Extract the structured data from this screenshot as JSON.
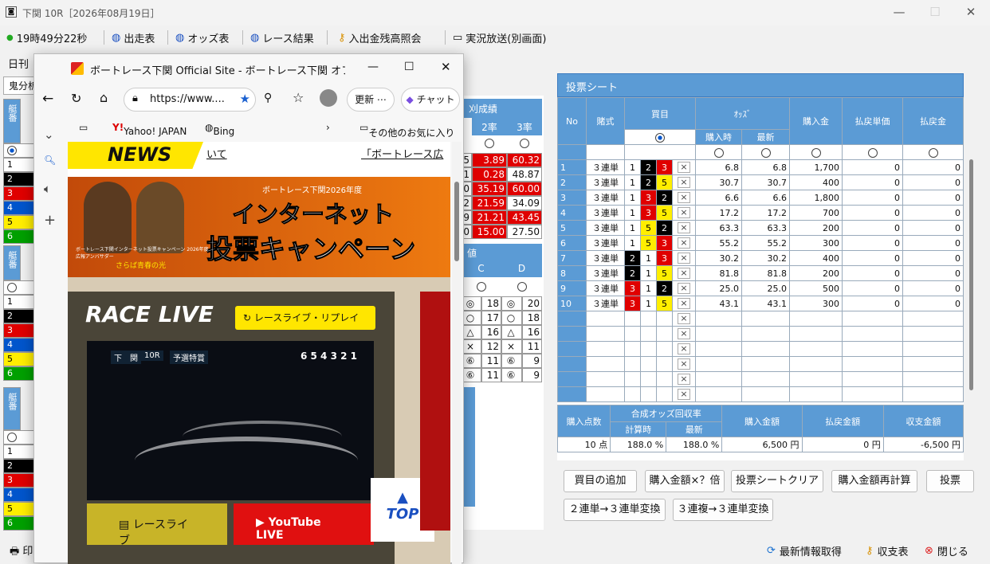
{
  "window": {
    "title": "下関 10R［2026年08月19日］",
    "icon": "app-icon"
  },
  "toolbar": {
    "clock": "19時49分22秒",
    "shussou": "出走表",
    "odds": "オッズ表",
    "result": "レース結果",
    "balance": "入出金残高照会",
    "live": "実況放送(別画面)"
  },
  "left_tabs": {
    "daily": "日刊",
    "bunseki": "鬼分析"
  },
  "bg_right": {
    "header": "刈成績",
    "col2": "2率",
    "col3": "3率",
    "rows": [
      [
        "5",
        "3.89",
        "60.32"
      ],
      [
        "1",
        "0.28",
        "48.87"
      ],
      [
        "0",
        "35.19",
        "60.00"
      ],
      [
        "2",
        "21.59",
        "34.09"
      ],
      [
        "9",
        "21.21",
        "43.45"
      ],
      [
        "0",
        "15.00",
        "27.50"
      ]
    ],
    "header2": "値",
    "colC": "C",
    "colD": "D",
    "rows2": [
      [
        "◎",
        "18",
        "◎",
        "20"
      ],
      [
        "○",
        "17",
        "○",
        "18"
      ],
      [
        "△",
        "16",
        "△",
        "16"
      ],
      [
        "×",
        "12",
        "×",
        "11"
      ],
      [
        "⑥",
        "11",
        "⑥",
        "9"
      ],
      [
        "⑥",
        "11",
        "⑥",
        "9"
      ]
    ]
  },
  "bg_left": {
    "h1": "艇番",
    "h2": "艇番",
    "h3": "艇番"
  },
  "sheet": {
    "title": "投票シート",
    "headers": {
      "no": "No",
      "shiki": "賭式",
      "kaime": "買目",
      "odds": "ｵｯｽﾞ",
      "odds_buy": "購入時",
      "odds_latest": "最新",
      "kounyu": "購入金",
      "haraimodoshi_tanka": "払戻単価",
      "haraimodoshi": "払戻金"
    },
    "rows": [
      {
        "no": "1",
        "shiki": "３連単",
        "a": "1",
        "b": "2",
        "c": "3",
        "o1": "6.8",
        "o2": "6.8",
        "amt": "1,700",
        "t": "0",
        "p": "0"
      },
      {
        "no": "2",
        "shiki": "３連単",
        "a": "1",
        "b": "2",
        "c": "5",
        "o1": "30.7",
        "o2": "30.7",
        "amt": "400",
        "t": "0",
        "p": "0"
      },
      {
        "no": "3",
        "shiki": "３連単",
        "a": "1",
        "b": "3",
        "c": "2",
        "o1": "6.6",
        "o2": "6.6",
        "amt": "1,800",
        "t": "0",
        "p": "0"
      },
      {
        "no": "4",
        "shiki": "３連単",
        "a": "1",
        "b": "3",
        "c": "5",
        "o1": "17.2",
        "o2": "17.2",
        "amt": "700",
        "t": "0",
        "p": "0"
      },
      {
        "no": "5",
        "shiki": "３連単",
        "a": "1",
        "b": "5",
        "c": "2",
        "o1": "63.3",
        "o2": "63.3",
        "amt": "200",
        "t": "0",
        "p": "0"
      },
      {
        "no": "6",
        "shiki": "３連単",
        "a": "1",
        "b": "5",
        "c": "3",
        "o1": "55.2",
        "o2": "55.2",
        "amt": "300",
        "t": "0",
        "p": "0"
      },
      {
        "no": "7",
        "shiki": "３連単",
        "a": "2",
        "b": "1",
        "c": "3",
        "o1": "30.2",
        "o2": "30.2",
        "amt": "400",
        "t": "0",
        "p": "0"
      },
      {
        "no": "8",
        "shiki": "３連単",
        "a": "2",
        "b": "1",
        "c": "5",
        "o1": "81.8",
        "o2": "81.8",
        "amt": "200",
        "t": "0",
        "p": "0"
      },
      {
        "no": "9",
        "shiki": "３連単",
        "a": "3",
        "b": "1",
        "c": "2",
        "o1": "25.0",
        "o2": "25.0",
        "amt": "500",
        "t": "0",
        "p": "0"
      },
      {
        "no": "10",
        "shiki": "３連単",
        "a": "3",
        "b": "1",
        "c": "5",
        "o1": "43.1",
        "o2": "43.1",
        "amt": "300",
        "t": "0",
        "p": "0"
      }
    ],
    "remove_mark": "×",
    "summary": {
      "h_points": "購入点数",
      "h_rate": "合成オッズ回収率",
      "h_calc": "計算時",
      "h_latest": "最新",
      "h_total": "購入金額",
      "h_refund": "払戻金額",
      "h_balance": "収支金額",
      "points": "10 点",
      "calc": "188.0 %",
      "latest": "188.0 %",
      "total": "6,500 円",
      "refund": "0 円",
      "balance": "-6,500 円"
    }
  },
  "buttons": {
    "add": "買目の追加",
    "multiply": "購入金額×？倍",
    "clear": "投票シートクリア",
    "recalc": "購入金額再計算",
    "vote": "投票",
    "conv2": "２連単→３連単変換",
    "conv3": "３連複→３連単変換"
  },
  "bottom": {
    "refresh": "最新情報取得",
    "shushi": "収支表",
    "close": "閉じる",
    "print": "印"
  },
  "browser": {
    "title": "ボートレース下関 Official Site - ボートレース下関 オフィシ...",
    "url": "https://www....",
    "update": "更新",
    "chat": "チャット",
    "fav1": "Yahoo! JAPAN",
    "fav2": "Bing",
    "fav_other": "その他のお気に入り",
    "news": "NEWS",
    "news_link1": "いて",
    "news_link2": "「ボートレース広",
    "banner_sub": "ボートレース下関2026年度",
    "banner_main1": "インターネット",
    "banner_main2": "投票キャンペーン",
    "banner_small": "ボートレース下関インターネット投票キャンペーン 2026年度広報アンバサダー",
    "banner_name": "さらば青春の光",
    "race_live": "RACE LIVE",
    "replay": "レースライブ・リプレイ",
    "btn_live": "レースライブ",
    "btn_youtube": "YouTube LIVE",
    "top": "TOP",
    "video_place": "下　関",
    "video_race": "10R",
    "video_type": "予選特賞",
    "video_nums": "6 5 4 3 2 1"
  }
}
